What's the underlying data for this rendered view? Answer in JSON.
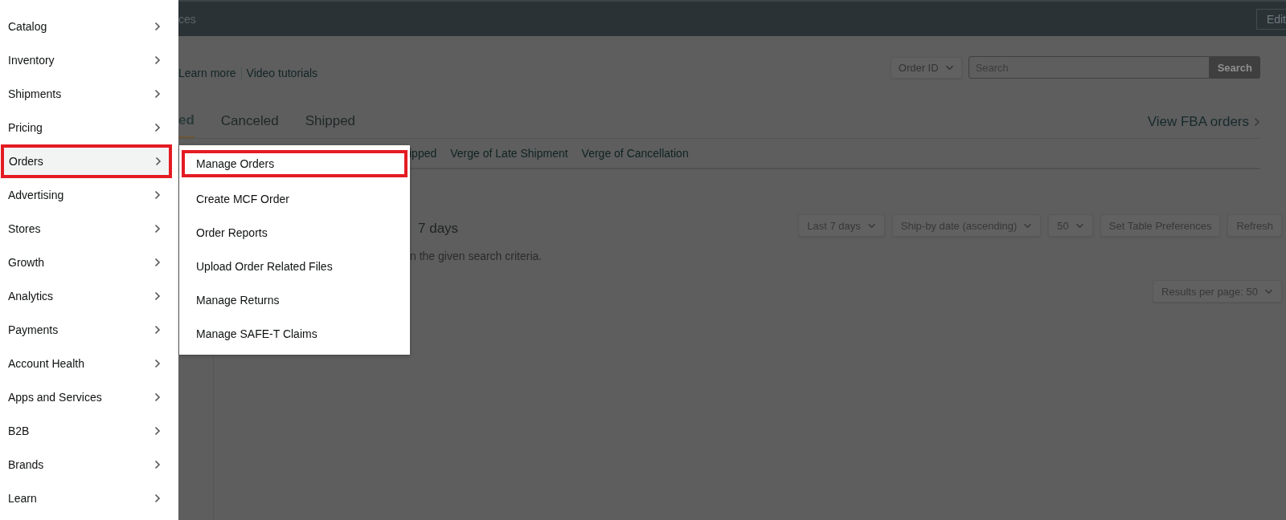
{
  "top_bar": {
    "text_fragment": "ces",
    "edit_button": "Edit"
  },
  "header": {
    "links": [
      "Learn more",
      "Video tutorials"
    ],
    "search_type": "Order ID",
    "search": {
      "placeholder": "Search"
    },
    "search_button": "Search"
  },
  "tabs": [
    {
      "label": "ed",
      "selected": true
    },
    {
      "label": "Canceled",
      "selected": false
    },
    {
      "label": "Shipped",
      "selected": false
    }
  ],
  "view_fba": "View FBA orders",
  "subtabs": [
    "ipped",
    "Verge of Late Shipment",
    "Verge of Cancellation"
  ],
  "period_text": "7 days",
  "message": "n the given search criteria.",
  "controls": [
    {
      "kind": "dropdown",
      "label": "Last 7 days"
    },
    {
      "kind": "dropdown",
      "label": "Ship-by date (ascending)"
    },
    {
      "kind": "dropdown",
      "label": "50"
    },
    {
      "kind": "button",
      "label": "Set Table Preferences"
    },
    {
      "kind": "button",
      "label": "Refresh"
    }
  ],
  "results_per_page": "Results per page: 50",
  "nav_menu": {
    "items": [
      {
        "label": "Catalog",
        "selected": false
      },
      {
        "label": "Inventory",
        "selected": false
      },
      {
        "label": "Shipments",
        "selected": false
      },
      {
        "label": "Pricing",
        "selected": false
      },
      {
        "label": "Orders",
        "selected": true
      },
      {
        "label": "Advertising",
        "selected": false
      },
      {
        "label": "Stores",
        "selected": false
      },
      {
        "label": "Growth",
        "selected": false
      },
      {
        "label": "Analytics",
        "selected": false
      },
      {
        "label": "Payments",
        "selected": false
      },
      {
        "label": "Account Health",
        "selected": false
      },
      {
        "label": "Apps and Services",
        "selected": false
      },
      {
        "label": "B2B",
        "selected": false
      },
      {
        "label": "Brands",
        "selected": false
      },
      {
        "label": "Learn",
        "selected": false
      }
    ]
  },
  "submenu": {
    "items": [
      {
        "label": "Manage Orders",
        "selected": true
      },
      {
        "label": "Create MCF Order",
        "selected": false
      },
      {
        "label": "Order Reports",
        "selected": false
      },
      {
        "label": "Upload Order Related Files",
        "selected": false
      },
      {
        "label": "Manage Returns",
        "selected": false
      },
      {
        "label": "Manage SAFE-T Claims",
        "selected": false
      }
    ]
  }
}
